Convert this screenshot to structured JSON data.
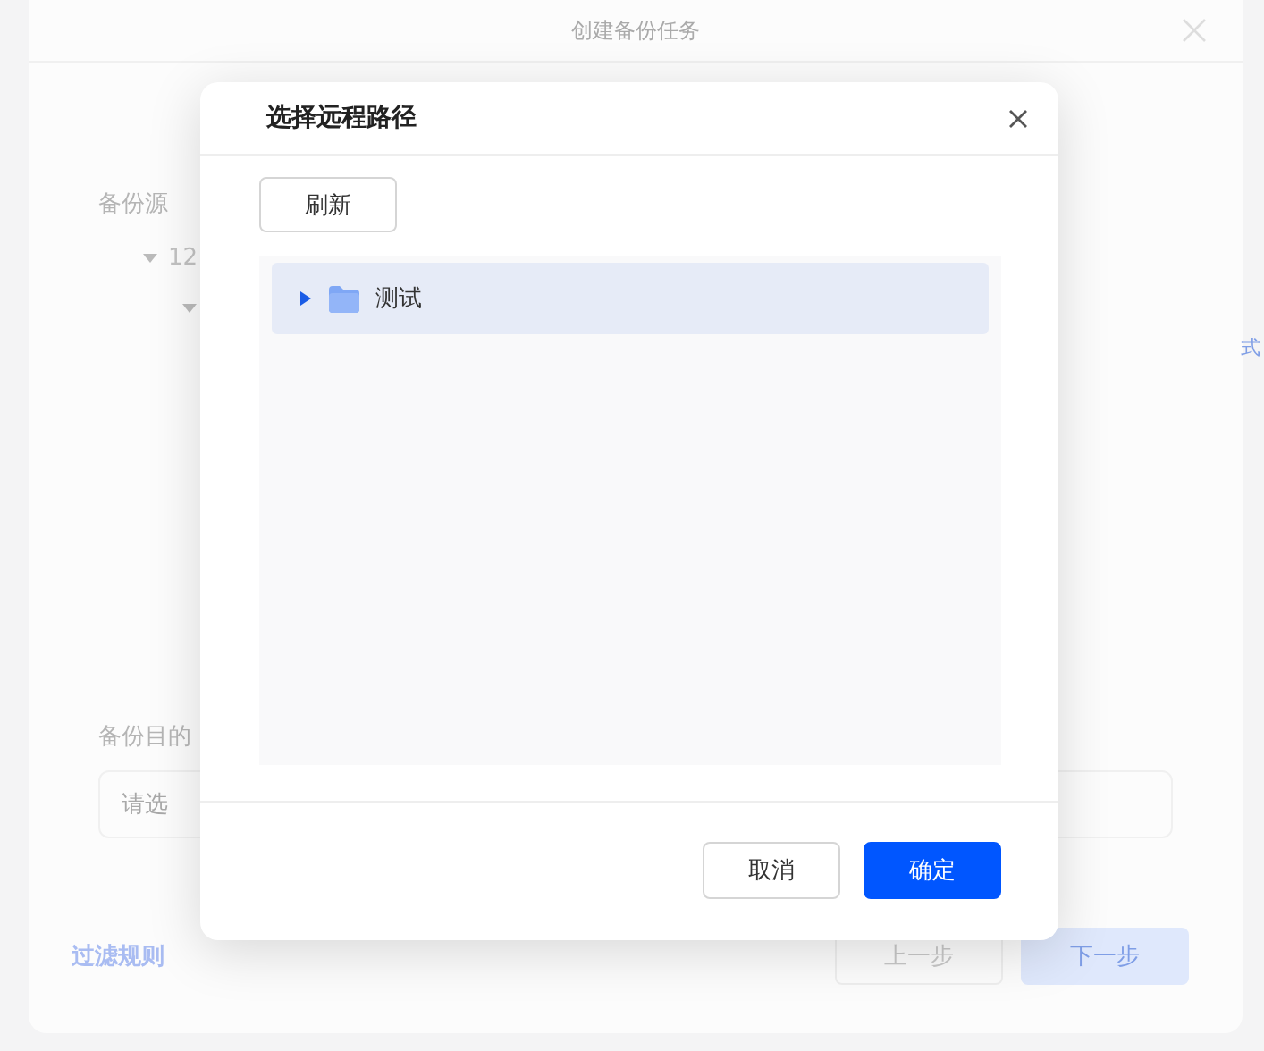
{
  "background_dialog": {
    "title": "创建备份任务",
    "source_label": "备份源",
    "source_tree": [
      {
        "label": "12",
        "expanded": true
      }
    ],
    "side_text": "式",
    "destination_label": "备份目的",
    "destination_field": {
      "placeholder": "请选"
    },
    "filter_link": "过滤规则",
    "buttons": [
      "上一步",
      "下一步"
    ]
  },
  "modal": {
    "title": "选择远程路径",
    "refresh_button": "刷新",
    "tree": [
      {
        "label": "测试",
        "expanded": false,
        "selected": true
      }
    ],
    "buttons": [
      {
        "label": "取消",
        "kind": "default"
      },
      {
        "label": "确定",
        "kind": "primary"
      }
    ]
  }
}
